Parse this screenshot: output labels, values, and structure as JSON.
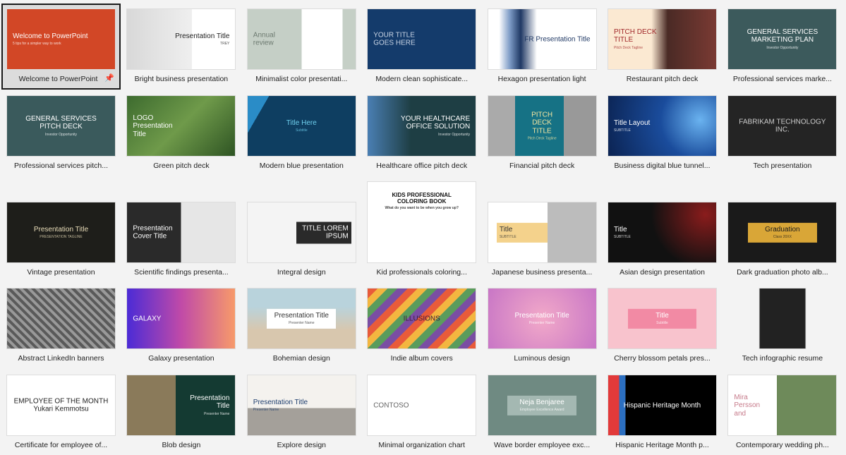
{
  "rows": [
    [
      {
        "label": "Welcome to PowerPoint",
        "title": "Welcome to PowerPoint",
        "sub": "5 tips for a simpler way to work",
        "bg": "#d24726",
        "fg": "#ffffff",
        "align": "left",
        "selected": true,
        "pinned": true
      },
      {
        "label": "Bright business presentation",
        "title": "Presentation Title",
        "sub": "TREY",
        "bg": "linear-gradient(90deg,#d8d8d8 0%,#efefef 60%,#fff 60%)",
        "fg": "#222222",
        "align": "right"
      },
      {
        "label": "Minimalist color presentati...",
        "title": "Annual\nreview",
        "bg": "linear-gradient(90deg,#c5cfc6 50%,#fff 50%,#fff 88%,#c5cfc6 88%)",
        "fg": "#6d7a70",
        "align": "left"
      },
      {
        "label": "Modern clean sophisticate...",
        "title": "YOUR TITLE\nGOES HERE",
        "bg": "#143b6b",
        "fg": "#c9d4e4",
        "align": "left"
      },
      {
        "label": "Hexagon presentation light",
        "title": "FR   Presentation Title",
        "bg": "linear-gradient(90deg,#fff 10%,#7d9bc6 20%,#1f3864 30%,#fff 45%)",
        "fg": "#1f3864",
        "align": "right"
      },
      {
        "label": "Restaurant pitch deck",
        "title": "PITCH DECK\nTITLE",
        "sub": "Pitch Deck Tagline",
        "bg": "linear-gradient(90deg,#fbe9d2 40%,#4a2a25 55%,#7a3a33 100%)",
        "fg": "#a1282a",
        "align": "left"
      },
      {
        "label": "Professional services marke...",
        "title": "GENERAL SERVICES\nMARKETING PLAN",
        "sub": "Investor Opportunity",
        "bg": "#3c5a5c",
        "fg": "#ffffff"
      }
    ],
    [
      {
        "label": "Professional services pitch...",
        "title": "GENERAL SERVICES\nPITCH DECK",
        "sub": "Investor Opportunity",
        "bg": "#3a5a5c",
        "fg": "#ffffff"
      },
      {
        "label": "Green pitch deck",
        "title": "LOGO\nPresentation\nTitle",
        "bg": "linear-gradient(135deg,#3d6b2f,#6f9a4a,#2e5423)",
        "fg": "#ffffff",
        "align": "left"
      },
      {
        "label": "Modern blue presentation",
        "title": "Title Here",
        "sub": "Subtitle",
        "bg": "linear-gradient(120deg,#2a8cc7 15%,#0e3e61 15%)",
        "fg": "#6fd0ee"
      },
      {
        "label": "Healthcare office pitch deck",
        "title": "YOUR HEALTHCARE\nOFFICE SOLUTION",
        "sub": "Investor Opportunity",
        "bg": "linear-gradient(90deg,#4a7fb3,#1e3e44 40%,#1e3e44)",
        "fg": "#ffffff",
        "align": "right"
      },
      {
        "label": "Financial pitch deck",
        "title": "PITCH\nDECK\nTITLE",
        "sub": "Pitch Deck Tagline",
        "bg": "linear-gradient(90deg,#aaa 25%,#167285 25%,#167285 70%,#999 70%)",
        "fg": "#f5e6a0"
      },
      {
        "label": "Business digital blue tunnel...",
        "title": "Title Layout",
        "sub": "SUBTITLE",
        "bg": "radial-gradient(circle at 85% 40%,#6ab3f0,#1a4c9c 40%,#0b2352)",
        "fg": "#ffffff",
        "align": "left"
      },
      {
        "label": "Tech presentation",
        "title": "FABRIKAM TECHNOLOGY INC.",
        "bg": "#242424",
        "fg": "#cccccc"
      }
    ],
    [
      {
        "label": "Vintage presentation",
        "title": "Presentation Title",
        "sub": "PRESENTATION TAGLINE",
        "bg": "#1e1e1a",
        "fg": "#e8dcb8"
      },
      {
        "label": "Scientific findings presenta...",
        "title": "Presentation\nCover Title",
        "bg": "linear-gradient(90deg,#2a2a2a 50%,#e6e6e6 50%)",
        "fg": "#ffffff",
        "align": "left"
      },
      {
        "label": "Integral design",
        "title": "TITLE LOREM IPSUM",
        "bg": "#f4f4f4",
        "fg": "#ffffff",
        "align": "right",
        "box": "#2a2a2a"
      },
      {
        "label": "Kid professionals coloring...",
        "title": "KIDS PROFESSIONAL\nCOLORING BOOK",
        "sub": "What do you want to be when you grow up?",
        "bg": "#ffffff",
        "fg": "#111111",
        "tall": true
      },
      {
        "label": "Japanese business presenta...",
        "title": "Title",
        "sub": "SUBTITLE",
        "bg": "linear-gradient(90deg,#fff 55%,#bcbcbc 55%)",
        "fg": "#333333",
        "align": "left",
        "box": "#f4d28c"
      },
      {
        "label": "Asian design presentation",
        "title": "Title",
        "sub": "SUBTITLE",
        "bg": "radial-gradient(circle at 90% 20%,#8a1c1c,#111 50%)",
        "fg": "#ffffff",
        "align": "left"
      },
      {
        "label": "Dark graduation photo alb...",
        "title": "Graduation",
        "sub": "Class 20XX",
        "bg": "#1a1a1a",
        "fg": "#1a1a1a",
        "box": "#d9a637"
      }
    ],
    [
      {
        "label": "Abstract LinkedIn banners",
        "title": "",
        "bg": "repeating-linear-gradient(45deg,#999 0 4px,#5a5a5a 4px 8px)",
        "fg": "#ffffff"
      },
      {
        "label": "Galaxy presentation",
        "title": "GALAXY",
        "bg": "linear-gradient(90deg,#4b2bd6,#c04aa8,#f79a6a)",
        "fg": "#ffffff",
        "align": "left"
      },
      {
        "label": "Bohemian design",
        "title": "Presentation Title",
        "sub": "Presenter Name",
        "bg": "linear-gradient(180deg,#b9d3dc 30%,#d8c7ae 70%)",
        "fg": "#333333",
        "box": "#ffffff"
      },
      {
        "label": "Indie album covers",
        "title": "ILLUSIONS",
        "bg": "repeating-linear-gradient(135deg,#e85b3a 0 10px,#f3b640 10px 20px,#5a9c5c 20px 30px,#7a4ea3 30px 40px)",
        "fg": "#3a1a3a"
      },
      {
        "label": "Luminous design",
        "title": "Presentation Title",
        "sub": "Presenter Name",
        "bg": "radial-gradient(circle,#f2a9c8,#c876c6)",
        "fg": "#ffffff"
      },
      {
        "label": "Cherry blossom petals pres...",
        "title": "Title",
        "sub": "Subtitle",
        "bg": "#f8c3cd",
        "fg": "#ffffff",
        "box": "#f28aa4"
      },
      {
        "label": "Tech infographic resume",
        "title": "",
        "bg": "#222222",
        "fg": "#f2e24a",
        "portrait": true
      }
    ],
    [
      {
        "label": "Certificate for employee of...",
        "title": "EMPLOYEE OF THE MONTH\nYukari Kemmotsu",
        "bg": "#ffffff",
        "fg": "#222222"
      },
      {
        "label": "Blob design",
        "title": "Presentation\nTitle",
        "sub": "Presenter Name",
        "bg": "linear-gradient(90deg,#8a7a5a 45%,#143a32 45%)",
        "fg": "#ffffff",
        "align": "right"
      },
      {
        "label": "Explore design",
        "title": "Presentation Title",
        "sub": "Presenter Name",
        "bg": "linear-gradient(180deg,#f4f2ee 55%,#a4a09a 55%)",
        "fg": "#1e3e6e",
        "align": "left"
      },
      {
        "label": "Minimal organization chart",
        "title": "CONTOSO",
        "bg": "#ffffff",
        "fg": "#666666",
        "align": "left"
      },
      {
        "label": "Wave border employee exc...",
        "title": "Neja Benjaree",
        "sub": "Employee Excellence Award",
        "bg": "#6f8a82",
        "fg": "#ffffff",
        "box": "#a4b8b2"
      },
      {
        "label": "Hispanic Heritage Month p...",
        "title": "Hispanic Heritage Month",
        "bg": "linear-gradient(90deg,#e23a3a 10%,#2c6fc0 10%,#2c6fc0 16%,#000 16%)",
        "fg": "#ffffff"
      },
      {
        "label": "Contemporary wedding ph...",
        "title": "Mira\nPersson\nand",
        "bg": "linear-gradient(90deg,#fff 45%,#6e8a5a 45%)",
        "fg": "#c67a8a",
        "align": "left"
      }
    ]
  ]
}
